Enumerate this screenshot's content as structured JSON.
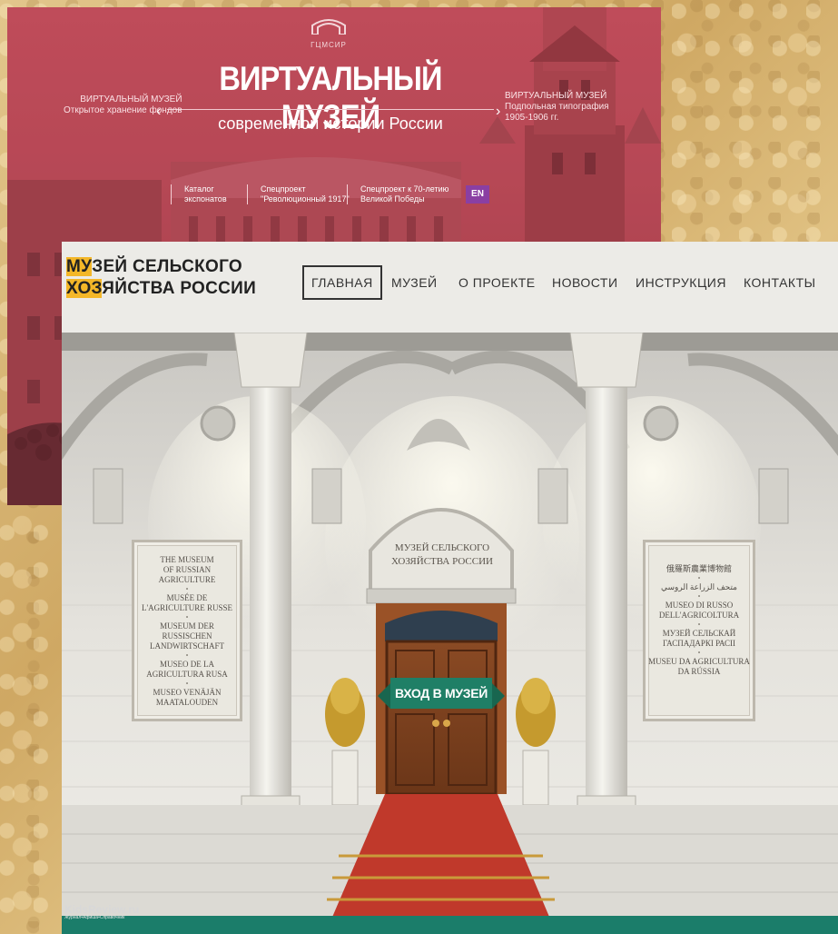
{
  "virtual_museum": {
    "logo_text": "ГЦМСИР",
    "title": "ВИРТУАЛЬНЫЙ МУЗЕЙ",
    "subtitle": "современной истории России",
    "left_link": {
      "line1": "ВИРТУАЛЬНЫЙ МУЗЕЙ",
      "line2": "Открытое хранение фондов"
    },
    "right_link": {
      "line1": "ВИРТУАЛЬНЫЙ МУЗЕЙ",
      "line2": "Подпольная типография",
      "line3": "1905-1906 гг."
    },
    "menu": [
      {
        "line1": "Каталог",
        "line2": "экспонатов"
      },
      {
        "line1": "Спецпроект",
        "line2": "\"Революционный 1917\""
      },
      {
        "line1": "Спецпроект к 70-летию",
        "line2": "Великой Победы"
      }
    ],
    "lang_button": "EN",
    "accent_color": "#b24a55"
  },
  "agri_museum": {
    "logo": {
      "line1_hl": "МУ",
      "line1": "ЗЕЙ СЕЛЬСКОГО",
      "line2_hl": "ХОЗ",
      "line2": "ЯЙСТВА РОССИИ"
    },
    "nav": [
      "ГЛАВНАЯ",
      "МУЗЕЙ",
      "О ПРОЕКТЕ",
      "НОВОСТИ",
      "ИНСТРУКЦИЯ",
      "КОНТАКТЫ"
    ],
    "active_nav": "ГЛАВНАЯ",
    "arch_sign": {
      "line1": "МУЗЕЙ СЕЛЬСКОГО",
      "line2": "ХОЗЯЙСТВА РОССИИ"
    },
    "enter_button": "ВХОД В МУЗЕЙ",
    "left_plaque": [
      "THE MUSEUM",
      "OF RUSSIAN AGRICULTURE",
      "MUSÉE DE",
      "L'AGRICULTURE RUSSE",
      "MUSEUM DER RUSSISCHEN",
      "LANDWIRTSCHAFT",
      "MUSEO DE LA",
      "AGRICULTURA RUSA",
      "MUSEO VENÄJÄN",
      "MAATALOUDEN"
    ],
    "right_plaque": [
      "俄羅斯農業博物館",
      "متحف الزراعة الروسي",
      "MUSEO DI RUSSO",
      "DELL'AGRICOLTURA",
      "МУЗЕЙ СЕЛЬСКАЙ",
      "ГАСПАДАРКІ РАСІІ",
      "MUSEU DA AGRICULTURA",
      "DA RÚSSIA"
    ],
    "watermark": {
      "name": "KidsReview.ru",
      "tagline": "Журнал•Афиша•Справочник"
    },
    "accent_color": "#1f7f66",
    "logo_highlight_color": "#f4b728",
    "carpet_color": "#c0392b"
  }
}
